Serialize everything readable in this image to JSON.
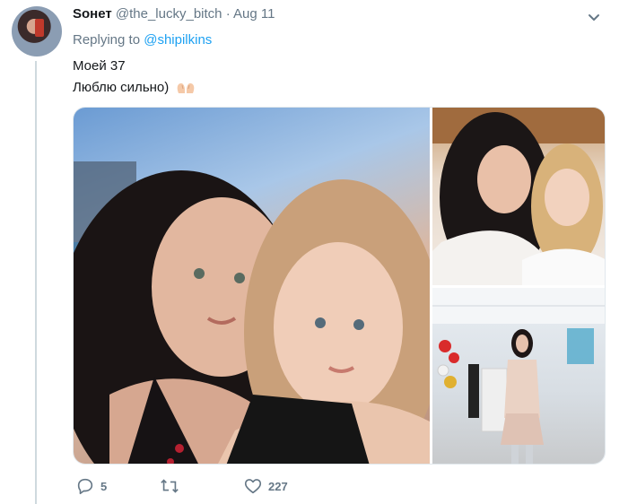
{
  "tweet": {
    "author_name": "Sонет",
    "handle": "@the_lucky_bitch",
    "separator": "·",
    "date": "Aug 11",
    "replying_prefix": "Replying to",
    "replying_to": "@shipilkins",
    "lines": [
      "Моей 37",
      "Люблю сильно)"
    ],
    "emoji_icon": "heart-hands-icon",
    "media": [
      {
        "icon": "photo-mother-daughter-selfie"
      },
      {
        "icon": "photo-mother-daughter-indoor"
      },
      {
        "icon": "photo-mother-balloons-room"
      }
    ]
  },
  "actions": {
    "reply_count": "5",
    "retweet_count": "",
    "like_count": "227"
  },
  "colors": {
    "link": "#1da1f2",
    "secondary_text": "#657786",
    "primary_text": "#14171a"
  }
}
